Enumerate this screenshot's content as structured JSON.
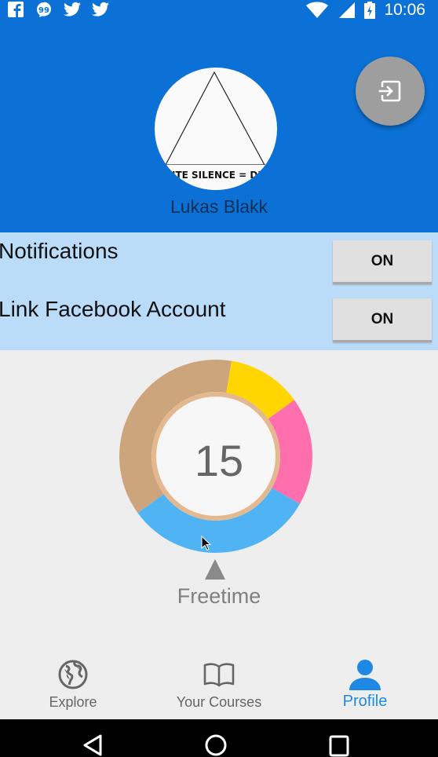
{
  "status_bar": {
    "time": "10:06",
    "left_icons": [
      "facebook-icon",
      "quote-icon",
      "twitter-icon",
      "twitter-icon"
    ],
    "right_icons": [
      "wifi-icon",
      "signal-icon",
      "battery-icon"
    ]
  },
  "header": {
    "avatar_caption": "NTE SILENCE = DE",
    "user_name": "Lukas Blakk",
    "fab_icon": "logout-icon",
    "color": "#0c71d6"
  },
  "settings": {
    "items": [
      {
        "label": "Notifications",
        "button_label": "ON"
      },
      {
        "label": "Link Facebook Account",
        "button_label": "ON"
      }
    ],
    "color": "#bbdcf9"
  },
  "donut": {
    "count": "15",
    "selected_category": "Freetime",
    "segments": [
      {
        "color": "#cda57c",
        "share": 0.376
      },
      {
        "color": "#ffd600",
        "share": 0.125
      },
      {
        "color": "#ff6fae",
        "share": 0.181
      },
      {
        "color": "#4fb3f4",
        "share": 0.318
      }
    ]
  },
  "bottom_nav": {
    "items": [
      {
        "label": "Explore",
        "icon": "globe-icon",
        "active": false
      },
      {
        "label": "Your Courses",
        "icon": "book-icon",
        "active": false
      },
      {
        "label": "Profile",
        "icon": "person-icon",
        "active": true
      }
    ],
    "active_color": "#1e88e5"
  },
  "system_nav": {
    "icons": [
      "back-icon",
      "home-icon",
      "recents-icon"
    ]
  }
}
